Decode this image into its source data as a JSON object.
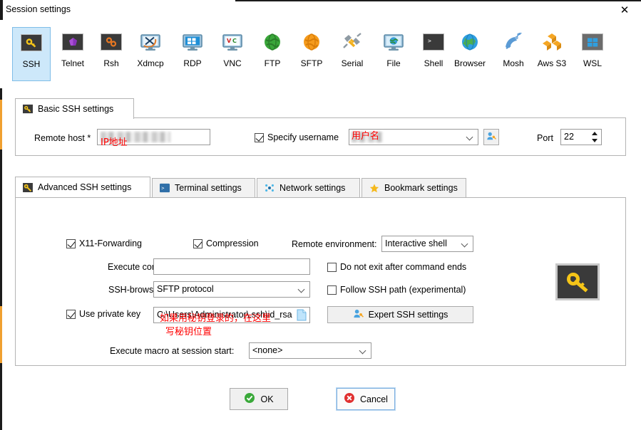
{
  "window": {
    "title": "Session settings",
    "close_label": "✕"
  },
  "session_types": [
    {
      "label": "SSH",
      "icon": "ssh-key-icon",
      "selected": true
    },
    {
      "label": "Telnet",
      "icon": "telnet-cube-icon",
      "selected": false
    },
    {
      "label": "Rsh",
      "icon": "rsh-gears-icon",
      "selected": false
    },
    {
      "label": "Xdmcp",
      "icon": "xdmcp-monitor-icon",
      "selected": false
    },
    {
      "label": "RDP",
      "icon": "rdp-monitor-icon",
      "selected": false
    },
    {
      "label": "VNC",
      "icon": "vnc-monitor-icon",
      "selected": false
    },
    {
      "label": "FTP",
      "icon": "ftp-globe-green-icon",
      "selected": false
    },
    {
      "label": "SFTP",
      "icon": "sftp-globe-orange-icon",
      "selected": false
    },
    {
      "label": "Serial",
      "icon": "serial-plug-icon",
      "selected": false
    },
    {
      "label": "File",
      "icon": "file-monitor-icon",
      "selected": false
    },
    {
      "label": "Shell",
      "icon": "shell-console-icon",
      "selected": false
    },
    {
      "label": "Browser",
      "icon": "browser-globe-icon",
      "selected": false
    },
    {
      "label": "Mosh",
      "icon": "mosh-satellite-icon",
      "selected": false
    },
    {
      "label": "Aws S3",
      "icon": "aws-s3-cubes-icon",
      "selected": false
    },
    {
      "label": "WSL",
      "icon": "wsl-windows-icon",
      "selected": false
    }
  ],
  "basic": {
    "tab_label": "Basic SSH settings",
    "tab_icon": "ssh-key-icon",
    "remote_host_label": "Remote host *",
    "remote_host_value": "",
    "remote_host_annotation": "IP地址",
    "specify_username_label": "Specify username",
    "specify_username_checked": true,
    "username_value": "",
    "username_annotation": "用户名",
    "user_picker_icon": "user-key-icon",
    "port_label": "Port",
    "port_value": "22"
  },
  "advanced_tabs": [
    {
      "label": "Advanced SSH settings",
      "icon": "ssh-key-icon",
      "active": true
    },
    {
      "label": "Terminal settings",
      "icon": "terminal-icon",
      "active": false
    },
    {
      "label": "Network settings",
      "icon": "network-dots-icon",
      "active": false
    },
    {
      "label": "Bookmark settings",
      "icon": "star-icon",
      "active": false
    }
  ],
  "advanced": {
    "x11_label": "X11-Forwarding",
    "x11_checked": true,
    "compression_label": "Compression",
    "compression_checked": true,
    "remote_env_label": "Remote environment:",
    "remote_env_value": "Interactive shell",
    "execute_command_label": "Execute command:",
    "execute_command_value": "",
    "do_not_exit_label": "Do not exit after command ends",
    "do_not_exit_checked": false,
    "ssh_browser_label": "SSH-browser type:",
    "ssh_browser_value": "SFTP protocol",
    "follow_ssh_path_label": "Follow SSH path (experimental)",
    "follow_ssh_path_checked": false,
    "use_private_key_label": "Use private key",
    "use_private_key_checked": true,
    "private_key_value": "C:\\Users\\Administrator\\.ssh\\id_rsa",
    "private_key_browse_icon": "file-browse-icon",
    "private_key_annotation_line1": "如果用秘钥登录的，在这里",
    "private_key_annotation_line2": "写秘钥位置",
    "expert_button_label": "Expert SSH settings",
    "expert_button_icon": "user-key-icon",
    "macro_label": "Execute macro at session start:",
    "macro_value": "<none>",
    "side_icon": "ssh-key-large-icon"
  },
  "footer": {
    "ok_label": "OK",
    "ok_icon": "green-check-icon",
    "cancel_label": "Cancel",
    "cancel_icon": "red-x-icon"
  },
  "colors": {
    "selection_blue": "#cde8fa",
    "annotation_red": "#ff0000",
    "key_yellow": "#f5c518",
    "ok_green": "#3aa93a",
    "cancel_red": "#e03030"
  }
}
